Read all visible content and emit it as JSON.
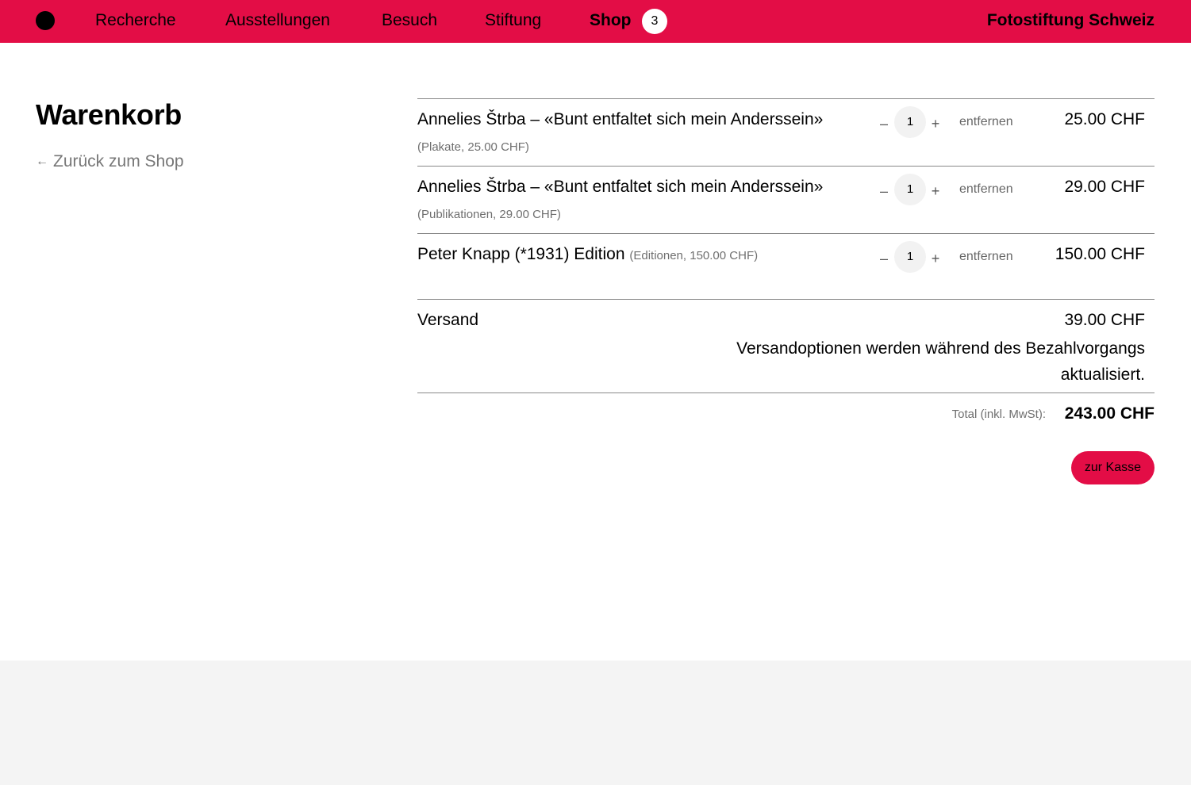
{
  "nav": {
    "items": [
      "Recherche",
      "Ausstellungen",
      "Besuch",
      "Stiftung"
    ],
    "shop_label": "Shop",
    "cart_count": "3",
    "brand": "Fotostiftung Schweiz"
  },
  "page": {
    "title": "Warenkorb",
    "back_link": "Zurück zum Shop"
  },
  "cart": {
    "items": [
      {
        "title": "Annelies Štrba – «Bunt entfaltet sich mein Anderssein»",
        "sub": "(Plakate, 25.00 CHF)",
        "qty": "1",
        "remove": "entfernen",
        "price": "25.00 CHF"
      },
      {
        "title": "Annelies Štrba – «Bunt entfaltet sich mein Anderssein»",
        "sub": "(Publikationen, 29.00 CHF)",
        "qty": "1",
        "remove": "entfernen",
        "price": "29.00 CHF"
      },
      {
        "title": "Peter Knapp (*1931) Edition",
        "sub": "(Editionen, 150.00 CHF)",
        "qty": "1",
        "remove": "entfernen",
        "price": "150.00 CHF"
      }
    ],
    "minus_symbol": "–",
    "plus_symbol": "+",
    "shipping_label": "Versand",
    "shipping_price": "39.00 CHF",
    "shipping_note": "Versandoptionen werden während des Bezahlvorgangs aktualisiert.",
    "total_label": "Total (inkl. MwSt):",
    "total_value": "243.00 CHF",
    "checkout_label": "zur Kasse"
  }
}
